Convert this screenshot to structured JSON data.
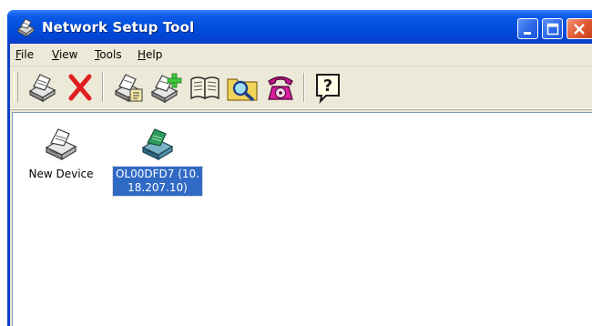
{
  "window": {
    "title": "Network Setup Tool",
    "icon": "printer-network-icon",
    "controls": [
      "minimize-icon",
      "maximize-icon",
      "close-icon"
    ]
  },
  "menu": {
    "items": [
      {
        "label": "File",
        "mnemonic": "F",
        "rest": "ile"
      },
      {
        "label": "View",
        "mnemonic": "V",
        "rest": "iew"
      },
      {
        "label": "Tools",
        "mnemonic": "T",
        "rest": "ools"
      },
      {
        "label": "Help",
        "mnemonic": "H",
        "rest": "elp"
      }
    ]
  },
  "toolbar": {
    "buttons": [
      {
        "icon": "printer-icon"
      },
      {
        "icon": "delete-x-icon"
      },
      {
        "icon": "printer-properties-icon"
      },
      {
        "icon": "printer-add-icon"
      },
      {
        "icon": "book-icon"
      },
      {
        "icon": "search-folder-icon"
      },
      {
        "icon": "telephone-icon"
      },
      {
        "icon": "help-icon",
        "glyph": "?"
      }
    ]
  },
  "devices": [
    {
      "label": "New Device",
      "icon": "printer-icon",
      "selected": false
    },
    {
      "label": "OL00DFD7 (10.18.207.10)",
      "icon": "printer-network-icon",
      "selected": true
    }
  ],
  "colors": {
    "titlebar": "#0050e0",
    "selection": "#316ac5",
    "delete": "#e01e1e",
    "help_border": "#1a1a1a"
  }
}
